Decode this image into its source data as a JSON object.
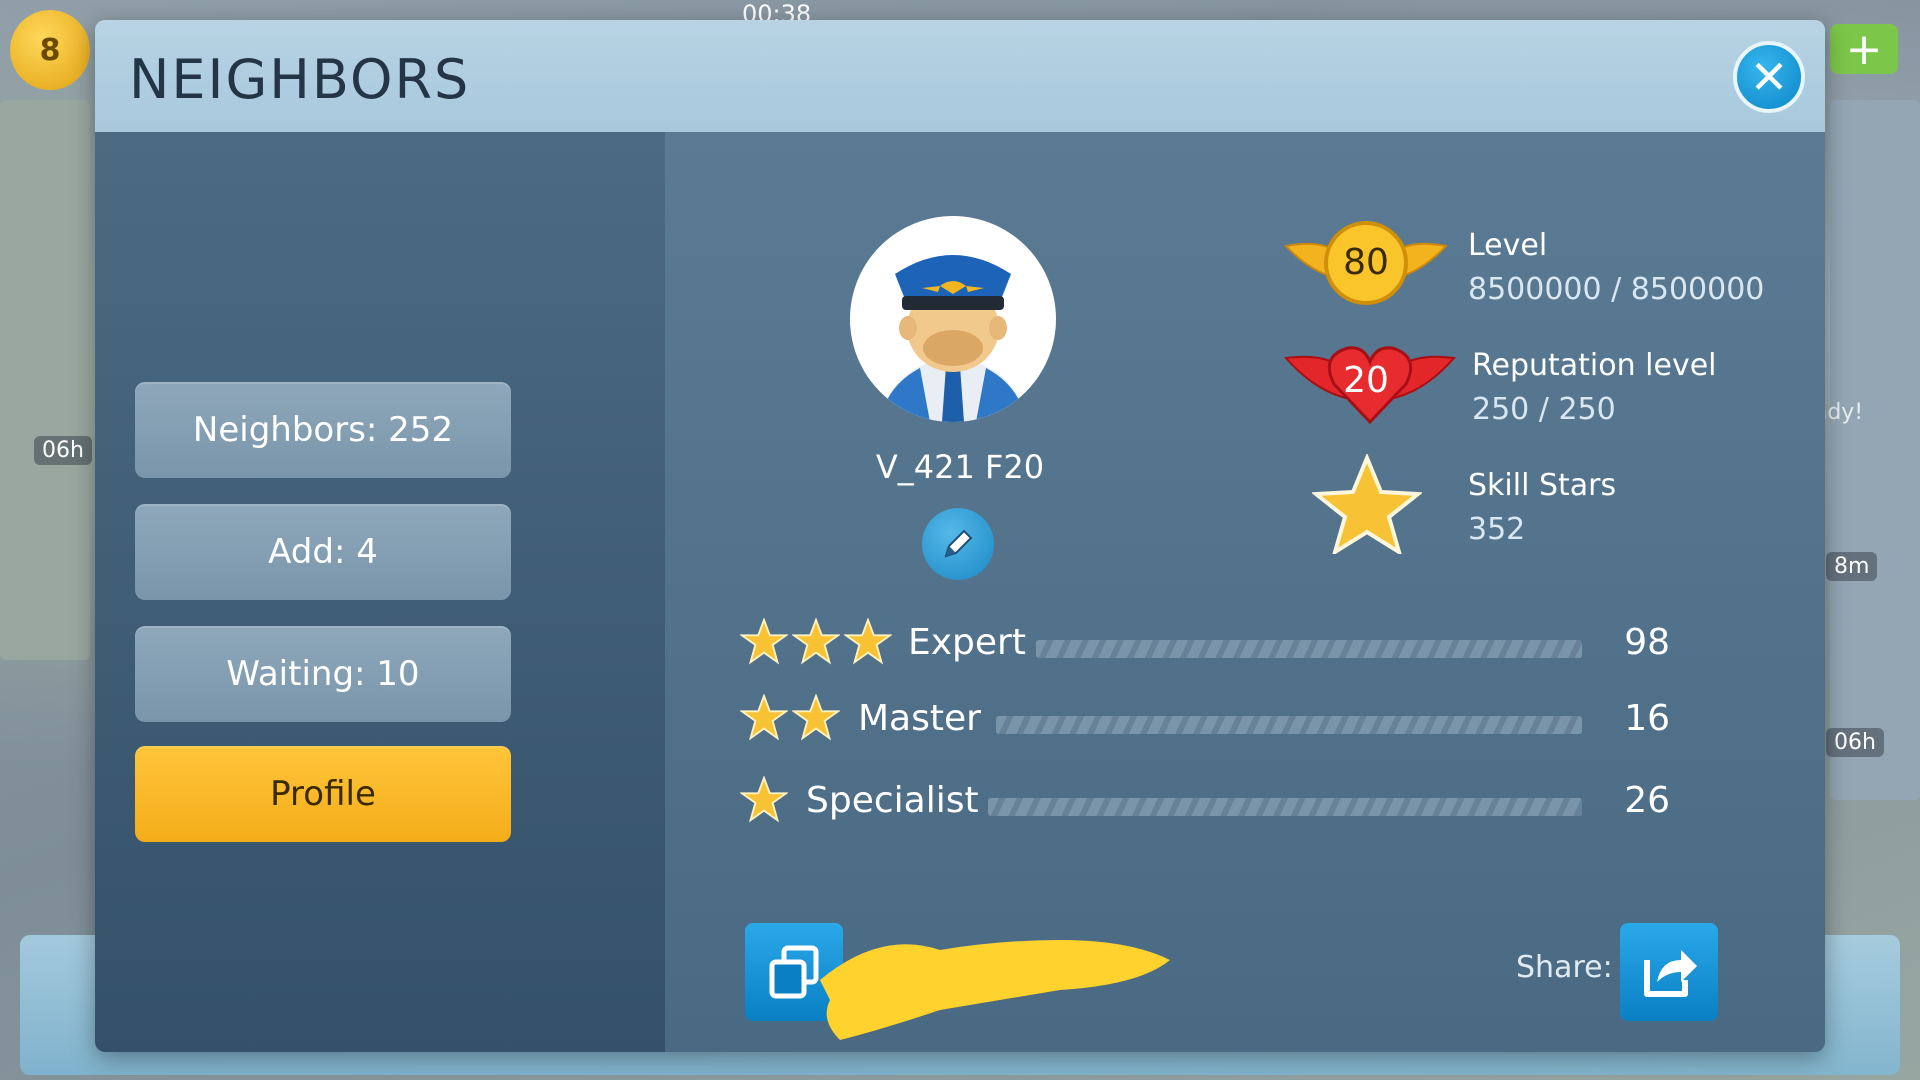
{
  "status_bar": {
    "time": "00:38"
  },
  "background": {
    "level_badge": "8",
    "timer_left": "06h",
    "timer_right": "06h",
    "timer_right_2": "8m",
    "ready_label": "Ready!"
  },
  "dialog": {
    "title": "NEIGHBORS",
    "close_icon": "close-icon"
  },
  "nav": {
    "neighbors": "Neighbors: 252",
    "add": "Add: 4",
    "waiting": "Waiting: 10",
    "profile": "Profile"
  },
  "profile": {
    "username": "V_421 F20",
    "level": {
      "badge": "80",
      "label": "Level",
      "value": "8500000 / 8500000"
    },
    "reputation": {
      "badge": "20",
      "label": "Reputation level",
      "value": "250 / 250"
    },
    "skill_stars": {
      "label": "Skill Stars",
      "value": "352"
    }
  },
  "skills": [
    {
      "name": "Expert",
      "stars": 3,
      "count": "98"
    },
    {
      "name": "Master",
      "stars": 2,
      "count": "16"
    },
    {
      "name": "Specialist",
      "stars": 1,
      "count": "26"
    }
  ],
  "share": {
    "label": "Share:"
  },
  "colors": {
    "accent_yellow": "#f4ad19",
    "accent_blue": "#0a7fc4",
    "panel_dark": "#35516a"
  }
}
